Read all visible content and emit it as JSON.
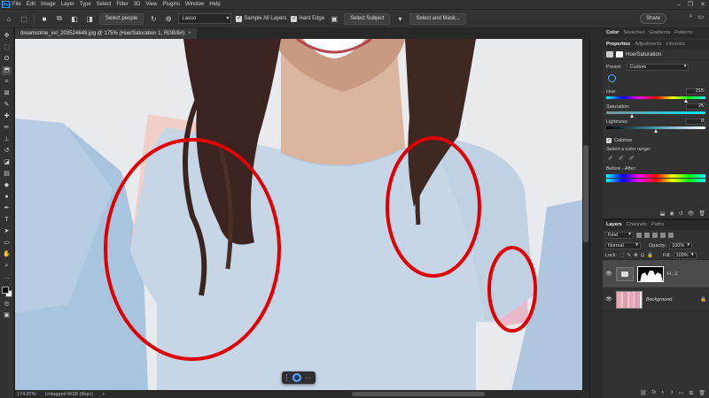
{
  "menubar": {
    "logo": "Ps",
    "items": [
      "File",
      "Edit",
      "Image",
      "Layer",
      "Type",
      "Select",
      "Filter",
      "3D",
      "View",
      "Plugins",
      "Window",
      "Help"
    ]
  },
  "options": {
    "select_people": "Select people",
    "tool_mode": "Lasso",
    "sample_all_layers": "Sample All Layers",
    "hard_edge": "Hard Edge",
    "select_subject": "Select Subject",
    "select_and_mask": "Select and Mask...",
    "share": "Share"
  },
  "document": {
    "tab_title": "dreamstime_xxl_203524649.jpg @ 175% (Hue/Saturation 1, RGB/8#)",
    "close": "×"
  },
  "status": {
    "zoom": "174.87%",
    "profile": "Untagged RGB (8bpc)",
    "arrow": ">"
  },
  "color_panel": {
    "tabs": [
      "Color",
      "Swatches",
      "Gradients",
      "Patterns"
    ]
  },
  "properties": {
    "tabs": [
      "Properties",
      "Adjustments",
      "Libraries"
    ],
    "header": "Hue/Saturation",
    "preset_label": "Preset:",
    "preset_value": "Custom",
    "hue_label": "Hue:",
    "hue_value": "215",
    "saturation_label": "Saturation:",
    "saturation_value": "25",
    "lightness_label": "Lightness:",
    "lightness_value": "0",
    "colorize_label": "Colorize",
    "colorize_checked": true,
    "select_range_label": "Select a color range:",
    "before_after_label": "Before - After:"
  },
  "layers": {
    "tabs": [
      "Layers",
      "Channels",
      "Paths"
    ],
    "kind": "Kind",
    "blend_mode": "Normal",
    "opacity_label": "Opacity:",
    "opacity_value": "100%",
    "lock_label": "Lock:",
    "fill_label": "Fill:",
    "fill_value": "100%",
    "items": [
      {
        "name": "H...1"
      },
      {
        "name": "Background"
      }
    ]
  },
  "colors": {
    "annotation_red": "#e00000",
    "accent_blue": "#58a6ff",
    "shirt": "#c3d3e3"
  }
}
